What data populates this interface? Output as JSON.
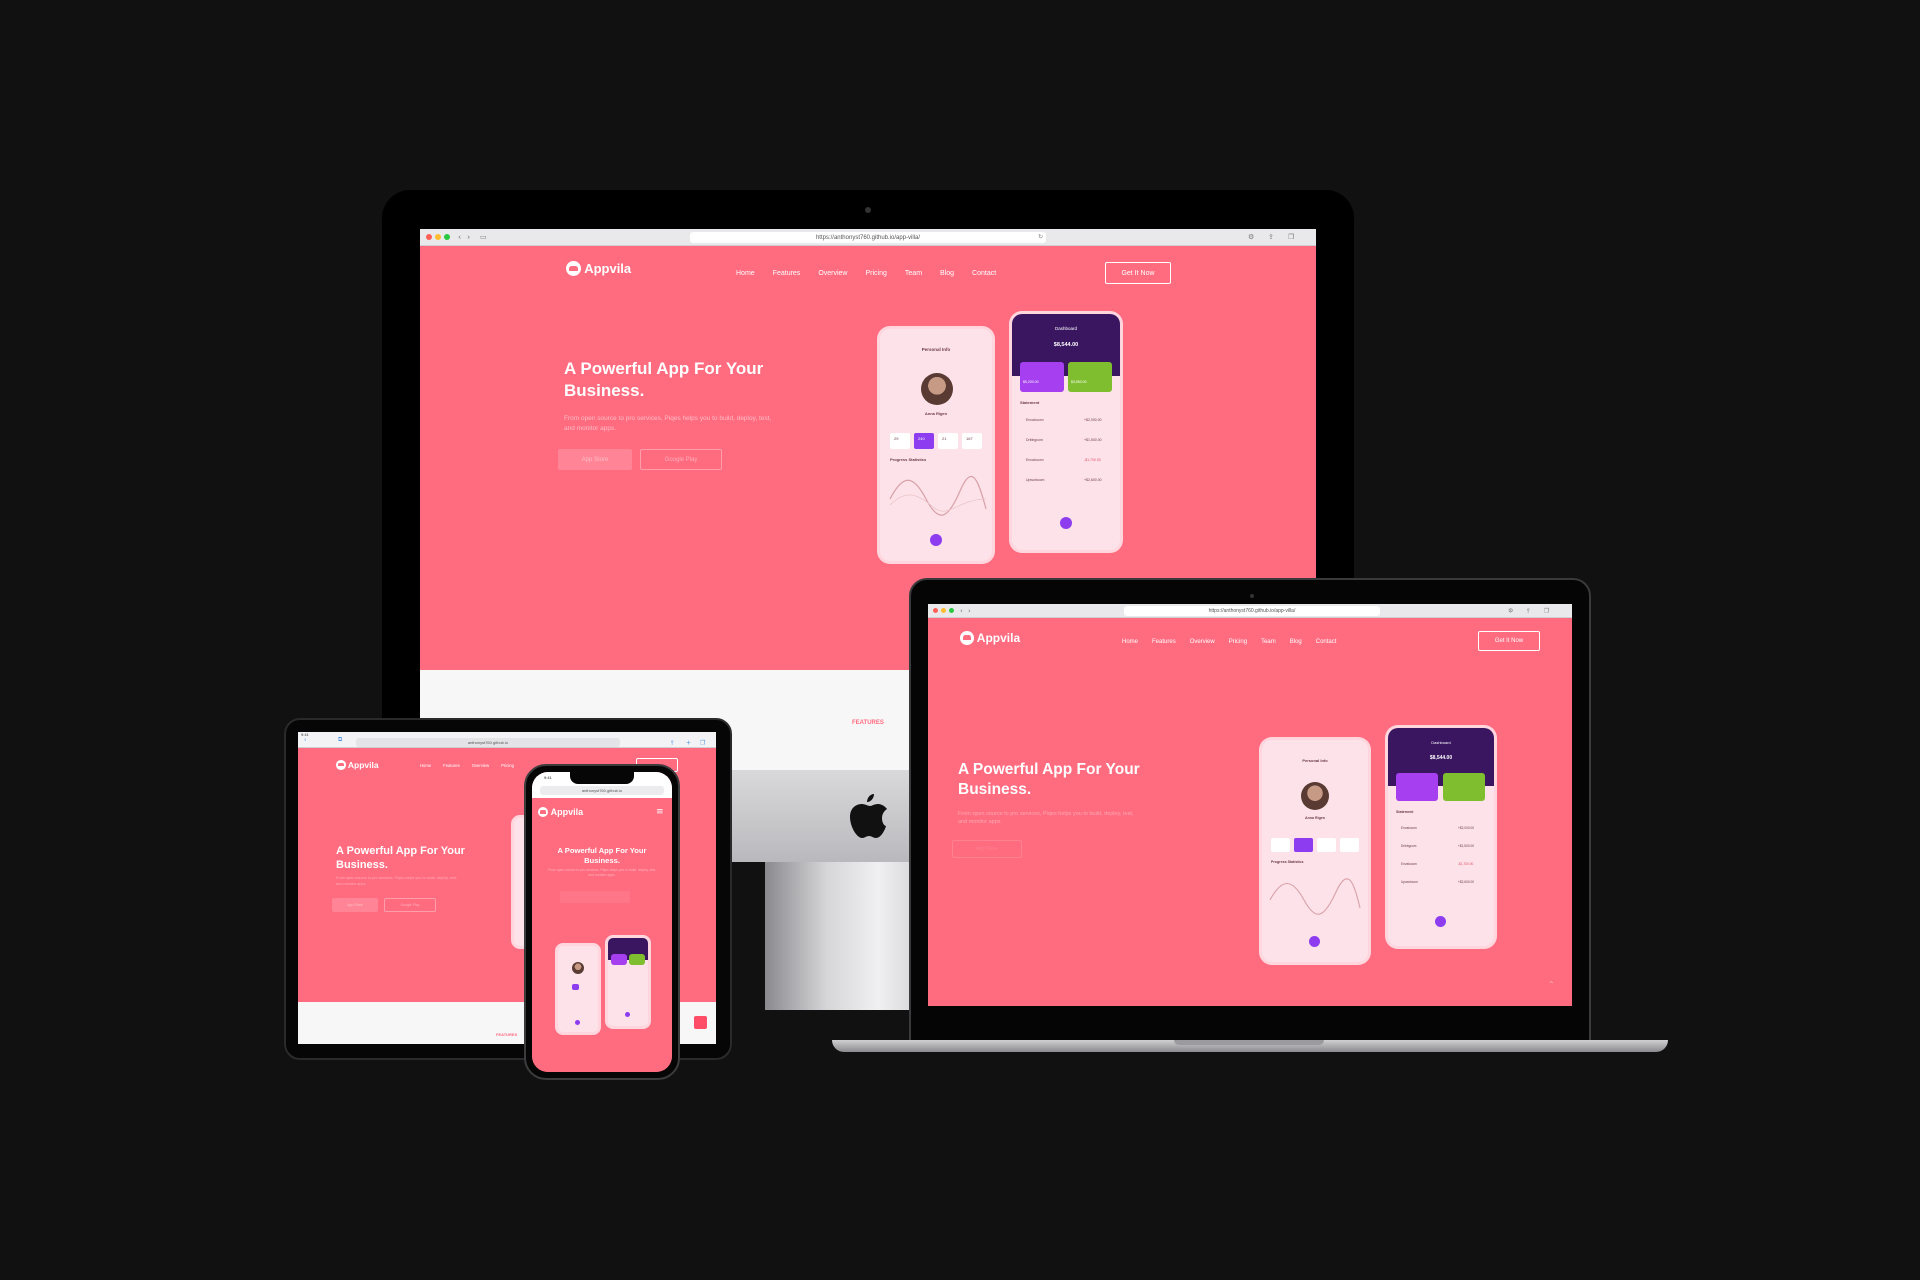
{
  "site": {
    "brand": "Appvila",
    "nav": [
      "Home",
      "Features",
      "Overview",
      "Pricing",
      "Team",
      "Blog",
      "Contact"
    ],
    "cta": "Get It Now",
    "hero_title_line1": "A Powerful App For Your",
    "hero_title_line2": "Business.",
    "hero_sub_line1": "From open source to pro services, Piqes helps you to build, deploy, test,",
    "hero_sub_line2": "and monitor apps.",
    "btn_app_store": "App Store",
    "btn_google_play": "Google Play",
    "features_tag": "FEATURES",
    "accent": "#ff6b7f"
  },
  "imac": {
    "url": "https://anthonyst760.github.io/app-villa/"
  },
  "macbook": {
    "url": "https://anthonyst760.github.io/app-villa/"
  },
  "ipad": {
    "url": "anthonyst760.github.io",
    "status_time": "9:41"
  },
  "iphone": {
    "url": "anthonyst760.github.io",
    "status_time": "9:41"
  },
  "phone_mock": {
    "personal_title": "Personal Info",
    "user_name": "Anna Rigen",
    "stats": [
      "29",
      "240",
      "21",
      "167"
    ],
    "chart_title": "Progress Statistics",
    "dashboard_title": "Dashboard",
    "balance": "$8,544.00",
    "card1": "$5,200.00",
    "card2": "$3,550.00",
    "statement_title": "Statement",
    "rows": [
      {
        "name": "Envatocom",
        "amount": "+$2,000.00"
      },
      {
        "name": "Dribbgcom",
        "amount": "+$1,500.00"
      },
      {
        "name": "Envatocom",
        "amount": "-$1,700.00"
      },
      {
        "name": "Upworkcom",
        "amount": "+$2,600.00"
      }
    ]
  },
  "icons": {
    "apple_logo": "apple-logo-icon",
    "menu": "hamburger-icon",
    "back_to_top": "chevron-up-icon"
  }
}
